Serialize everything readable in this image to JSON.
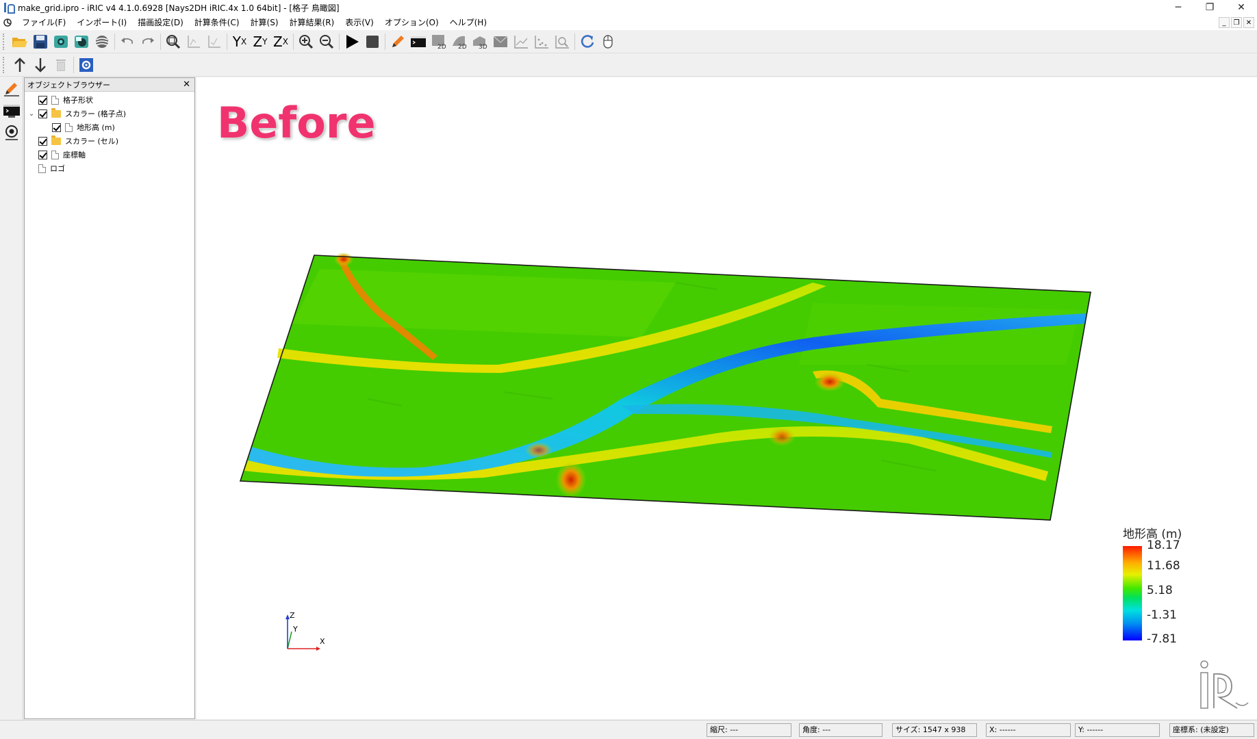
{
  "window": {
    "title": "make_grid.ipro - iRIC v4 4.1.0.6928 [Nays2DH iRIC.4x 1.0 64bit] - [格子 鳥瞰図]",
    "minimize": "─",
    "restore": "❐",
    "close": "✕"
  },
  "menu": {
    "items": [
      "ファイル(F)",
      "インポート(I)",
      "描画設定(D)",
      "計算条件(C)",
      "計算(S)",
      "計算結果(R)",
      "表示(V)",
      "オプション(O)",
      "ヘルプ(H)"
    ],
    "mdi_minimize": "_",
    "mdi_restore": "❐",
    "mdi_close": "✕"
  },
  "toolbar": {
    "axis_yx": "Y",
    "axis_yx_sub": "X",
    "axis_zy": "Z",
    "axis_zy_sub": "Y",
    "axis_zx": "Z",
    "axis_zx_sub": "X",
    "view_2d_a": "2D",
    "view_2d_b": "2D",
    "view_3d": "3D"
  },
  "object_browser": {
    "title": "オブジェクトブラウザー",
    "close": "✕",
    "items": [
      {
        "label": "格子形状"
      },
      {
        "label": "スカラー (格子点)"
      },
      {
        "label": "地形高 (m)"
      },
      {
        "label": "スカラー (セル)"
      },
      {
        "label": "座標軸"
      },
      {
        "label": "ロゴ"
      }
    ]
  },
  "viewport": {
    "overlay_label": "Before",
    "colorbar": {
      "title": "地形高 (m)",
      "ticks": [
        "18.17",
        "11.68",
        "5.18",
        "-1.31",
        "-7.81"
      ]
    },
    "axes": {
      "x": "X",
      "y": "Y",
      "z": "Z"
    }
  },
  "statusbar": {
    "scale": "縮尺: ---",
    "angle": "角度: ---",
    "size": "サイズ: 1547 x 938",
    "x": "X: ------",
    "y": "Y: ------",
    "crs": "座標系: (未設定)"
  },
  "colors": {
    "before_label": "#f0336f",
    "terrain_green": "#48d000",
    "river_blue": "#1aa8e8"
  }
}
